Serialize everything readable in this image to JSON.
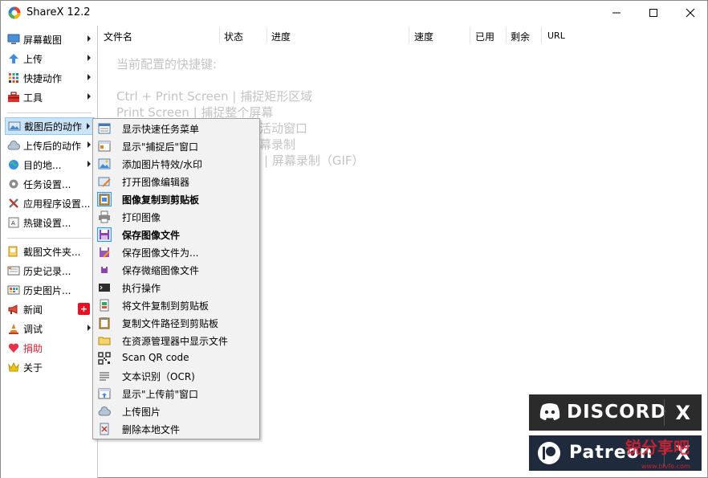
{
  "window": {
    "title": "ShareX 12.2"
  },
  "sidebar": {
    "items": [
      {
        "label": "屏幕截图",
        "icon": "monitor-icon"
      },
      {
        "label": "上传",
        "icon": "upload-arrow-icon"
      },
      {
        "label": "快捷动作",
        "icon": "grid-icon"
      },
      {
        "label": "工具",
        "icon": "toolbox-icon"
      },
      {
        "label": "截图后的动作",
        "icon": "image-screenshot-icon"
      },
      {
        "label": "上传后的动作",
        "icon": "cloud-icon"
      },
      {
        "label": "目的地...",
        "icon": "globe-icon"
      },
      {
        "label": "任务设置...",
        "icon": "gear-icon"
      },
      {
        "label": "应用程序设置...",
        "icon": "wrench-icon"
      },
      {
        "label": "热键设置...",
        "icon": "keyboard-icon"
      },
      {
        "label": "截图文件夹...",
        "icon": "folder-icon"
      },
      {
        "label": "历史记录...",
        "icon": "history-icon"
      },
      {
        "label": "历史图片...",
        "icon": "image-history-icon"
      },
      {
        "label": "新闻",
        "icon": "megaphone-icon"
      },
      {
        "label": "调试",
        "icon": "traffic-cone-icon"
      },
      {
        "label": "捐助",
        "icon": "heart-icon"
      },
      {
        "label": "关于",
        "icon": "crown-icon"
      }
    ],
    "news_badge": "+"
  },
  "table": {
    "columns": [
      "文件名",
      "状态",
      "进度",
      "速度",
      "已用",
      "剩余",
      "URL"
    ]
  },
  "hotkeys": {
    "title": "当前配置的快捷键:",
    "lines": [
      "Ctrl + Print Screen  |  捕捉矩形区域",
      "Print Screen  |  捕捉整个屏幕",
      "活动窗口",
      "幕录制",
      "|  屏幕录制（GIF）"
    ]
  },
  "submenu": {
    "items": [
      {
        "label": "显示快速任务菜单",
        "icon": "quick-task-menu-icon",
        "checked": false
      },
      {
        "label": "显示\"捕捉后\"窗口",
        "icon": "window-icon",
        "checked": false
      },
      {
        "label": "添加图片特效/水印",
        "icon": "image-effects-icon",
        "checked": false
      },
      {
        "label": "打开图像编辑器",
        "icon": "image-editor-icon",
        "checked": false
      },
      {
        "label": "图像复制到剪贴板",
        "icon": "clipboard-image-icon",
        "checked": true
      },
      {
        "label": "打印图像",
        "icon": "printer-icon",
        "checked": false
      },
      {
        "label": "保存图像文件",
        "icon": "save-icon",
        "checked": true
      },
      {
        "label": "保存图像文件为...",
        "icon": "save-as-icon",
        "checked": false
      },
      {
        "label": "保存微缩图像文件",
        "icon": "save-thumbnail-icon",
        "checked": false
      },
      {
        "label": "执行操作",
        "icon": "terminal-icon",
        "checked": false
      },
      {
        "label": "将文件复制到剪贴板",
        "icon": "clipboard-file-icon",
        "checked": false
      },
      {
        "label": "复制文件路径到剪贴板",
        "icon": "clipboard-path-icon",
        "checked": false
      },
      {
        "label": "在资源管理器中显示文件",
        "icon": "folder-open-icon",
        "checked": false
      },
      {
        "label": "Scan QR code",
        "icon": "qr-code-icon",
        "checked": false
      },
      {
        "label": "文本识别（OCR)",
        "icon": "ocr-text-icon",
        "checked": false
      },
      {
        "label": "显示\"上传前\"窗口",
        "icon": "window-upload-icon",
        "checked": false
      },
      {
        "label": "上传图片",
        "icon": "cloud-upload-icon",
        "checked": false
      },
      {
        "label": "删除本地文件",
        "icon": "delete-file-icon",
        "checked": false
      }
    ]
  },
  "banners": {
    "discord": {
      "label": "DISCORD",
      "close": "X"
    },
    "patreon": {
      "label": "Patreon",
      "close": "X"
    }
  },
  "watermark": {
    "text": "锐分享吧",
    "url": "www.blvfe.com"
  },
  "colors": {
    "selection": "#cce4f7",
    "selection_border": "#99c9ef",
    "banner_bg": "#2b2b2b",
    "badge_red": "#e81123"
  }
}
